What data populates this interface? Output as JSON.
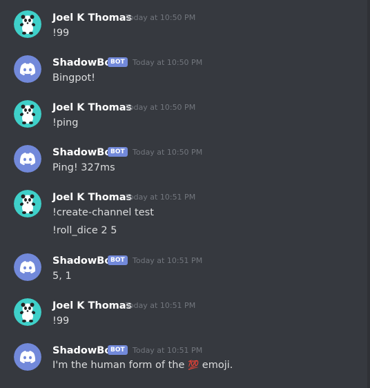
{
  "messages": [
    {
      "author": "Joel K Thomas",
      "type": "user",
      "time": "Today at 10:50 PM",
      "lines": [
        "!99"
      ]
    },
    {
      "author": "ShadowBot",
      "type": "bot",
      "badge": "BOT",
      "time": "Today at 10:50 PM",
      "lines": [
        "Bingpot!"
      ]
    },
    {
      "author": "Joel K Thomas",
      "type": "user",
      "time": "Today at 10:50 PM",
      "lines": [
        "!ping"
      ]
    },
    {
      "author": "ShadowBot",
      "type": "bot",
      "badge": "BOT",
      "time": "Today at 10:50 PM",
      "lines": [
        "Ping! 327ms"
      ]
    },
    {
      "author": "Joel K Thomas",
      "type": "user",
      "time": "Today at 10:51 PM",
      "lines": [
        "!create-channel test",
        "!roll_dice 2 5"
      ]
    },
    {
      "author": "ShadowBot",
      "type": "bot",
      "badge": "BOT",
      "time": "Today at 10:51 PM",
      "lines": [
        "5, 1"
      ]
    },
    {
      "author": "Joel K Thomas",
      "type": "user",
      "time": "Today at 10:51 PM",
      "lines": [
        "!99"
      ]
    },
    {
      "author": "ShadowBot",
      "type": "bot",
      "badge": "BOT",
      "time": "Today at 10:51 PM",
      "lines": [
        "I'm the human form of the",
        "emoji."
      ],
      "emoji": "💯"
    }
  ],
  "icons": {
    "user_avatar": "panda-avatar-icon",
    "bot_avatar": "discord-logo-icon",
    "emoji": "hundred-points-emoji"
  },
  "colors": {
    "background": "#36393f",
    "bot_badge": "#7289da",
    "user_avatar_bg": "#3fd0c9",
    "bot_avatar_bg": "#7289da",
    "username": "#ffffff",
    "message_text": "#dcddde",
    "timestamp": "#72767d"
  }
}
